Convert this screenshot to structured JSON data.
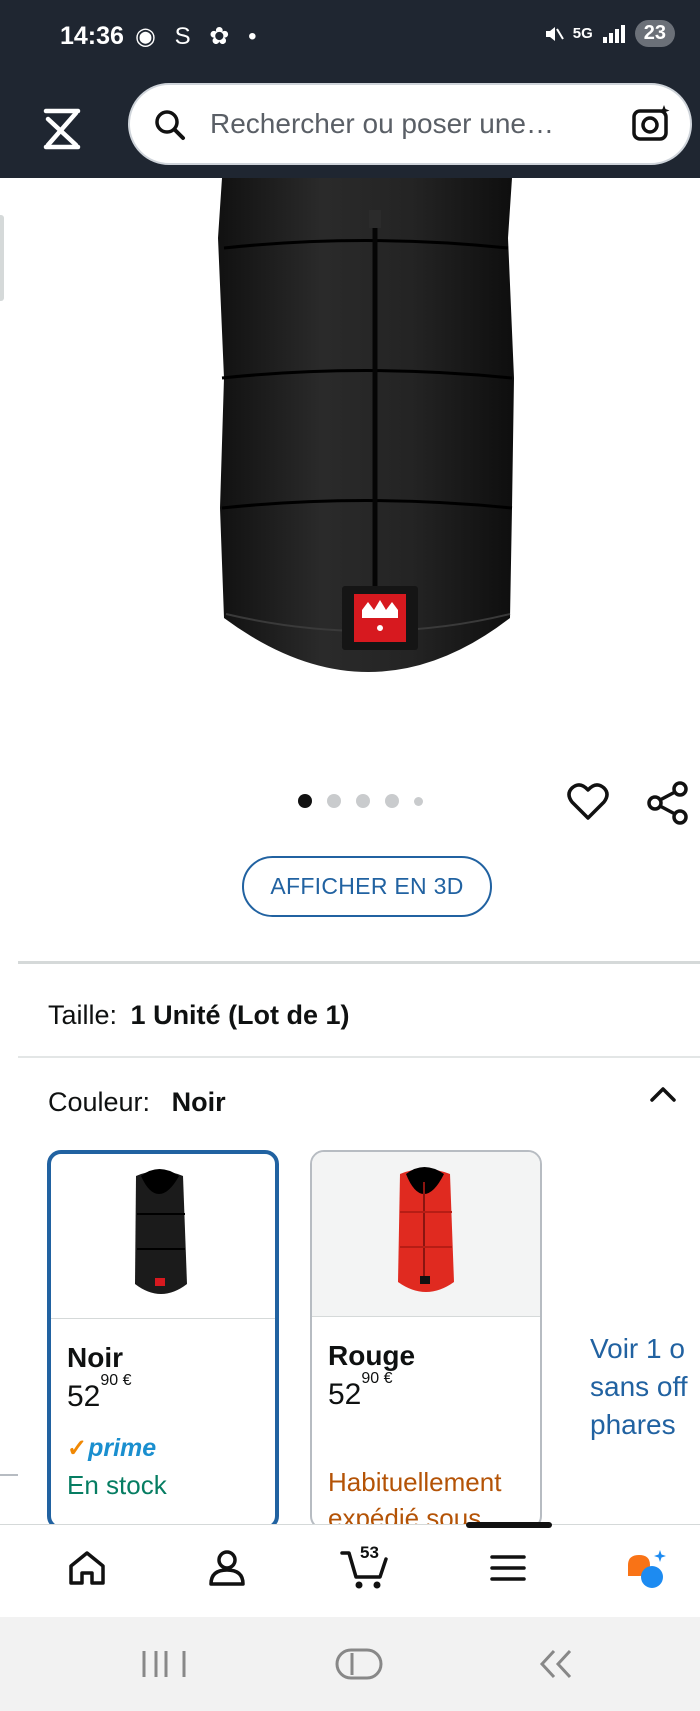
{
  "status_bar": {
    "time": "14:36",
    "icons_left": "◉ S ✿ •",
    "network": "5G",
    "battery": "23"
  },
  "header": {
    "search_placeholder": "Rechercher ou poser une…"
  },
  "product": {
    "image_alt": "Kaiser black footmuff",
    "carousel_total": 5,
    "carousel_active": 1,
    "view_3d_label": "AFFICHER EN 3D"
  },
  "variations": {
    "size_label": "Taille:",
    "size_value": "1 Unité (Lot de 1)",
    "color_label": "Couleur:",
    "color_value": "Noir",
    "swatches": [
      {
        "name": "Noir",
        "price_whole": "52",
        "price_fraction": "90",
        "currency": "€",
        "prime": "prime",
        "availability": "En stock"
      },
      {
        "name": "Rouge",
        "price_whole": "52",
        "price_fraction": "90",
        "currency": "€",
        "availability": "Habituellement expédié sous …"
      }
    ],
    "more_options": [
      "Voir 1 o",
      "sans off",
      "phares"
    ]
  },
  "bottom_nav": {
    "cart_count": "53"
  },
  "colors": {
    "header_bg": "#1f2631",
    "link_blue": "#2162a1",
    "stock_green": "#067d62",
    "ship_orange": "#b45306"
  }
}
